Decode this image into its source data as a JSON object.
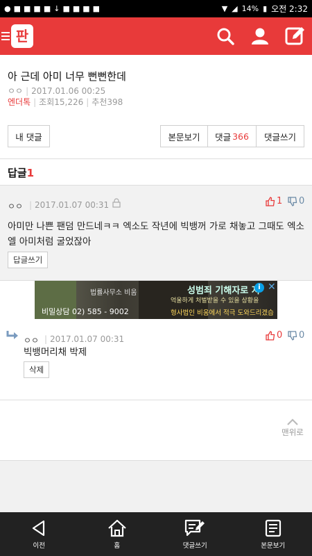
{
  "status_bar": {
    "battery": "14%",
    "time": "오전 2:32"
  },
  "header": {
    "logo": "판",
    "icons": [
      "search-icon",
      "user-icon",
      "write-icon"
    ]
  },
  "post": {
    "title": "아 근데 아미 너무 뻔뻔한데",
    "author": "ㅇㅇ",
    "datetime": "2017.01.06 00:25",
    "board": "엔더톡",
    "views_label": "조회15,226",
    "recommend_label": "추천398"
  },
  "buttons": {
    "my_comments": "내 댓글",
    "view_post": "본문보기",
    "comments_label": "댓글",
    "comments_count": "366",
    "write_comment": "댓글쓰기"
  },
  "reply_section": {
    "label": "답글",
    "count": "1"
  },
  "comments": [
    {
      "author": "ㅇㅇ",
      "datetime": "2017.01.07 00:31",
      "likes": "1",
      "dislikes": "0",
      "text": "아미만 나쁜 팬덤 만드네ㅋㅋ 엑소도 작년에 빅뱅꺼 가로 채놓고 그때도 엑소엘 아미처럼 굴었잖아",
      "action": "답글쓰기"
    },
    {
      "author": "ㅇㅇ",
      "datetime": "2017.01.07 00:31",
      "likes": "0",
      "dislikes": "0",
      "text": "빅뱅머리채 박제",
      "action": "삭제"
    }
  ],
  "ad": {
    "brand": "법률사무소 비움",
    "phone": "비밀상담 02) 585 - 9002",
    "headline": "성범죄 기해자로 지",
    "line2": "억울하게 처벌받을 수 있을 상황을",
    "line3": "형사법인 비움에서 적극 도와드리겠습니다."
  },
  "go_top": "맨위로",
  "bottom_nav": [
    {
      "icon": "back-icon",
      "label": "이전"
    },
    {
      "icon": "home-icon",
      "label": "홈"
    },
    {
      "icon": "write-comment-icon",
      "label": "댓글쓰기"
    },
    {
      "icon": "document-icon",
      "label": "본문보기"
    }
  ],
  "colors": {
    "accent": "#e83a3a",
    "nav_bg": "#222222",
    "comment_bg": "#f2f2f2"
  }
}
